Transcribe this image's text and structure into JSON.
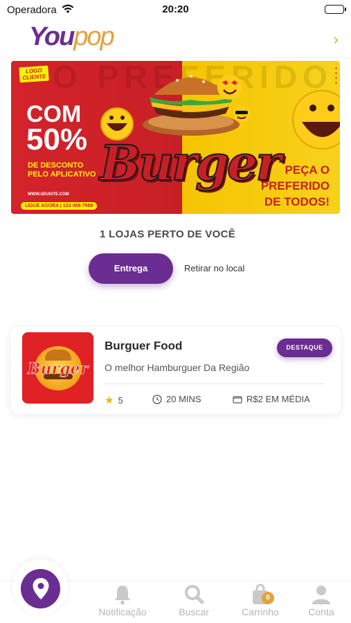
{
  "status_bar": {
    "carrier": "Operadora",
    "time": "20:20"
  },
  "header": {
    "logo_part1": "You",
    "logo_part2": "pop",
    "chevron": "›"
  },
  "banner": {
    "bg_word": "O PREFERIDO",
    "logo_tag_1": "LOGO",
    "logo_tag_2": "CLIENTE",
    "headline_1": "COM",
    "headline_2": "50%",
    "subline_1": "DE DESCONTO",
    "subline_2": "PELO APLICATIVO",
    "site": "WWW.SEUSITE.COM",
    "phone": "LIGUE AGORA | 123-456-7689",
    "burger_word": "Burger",
    "cta_1": "PEÇA O",
    "cta_2": "PREFERIDO",
    "cta_3": "DE TODOS!"
  },
  "section_title": "1 LOJAS PERTO DE VOCÊ",
  "tabs": {
    "active": "Entrega",
    "inactive": "Retirar no local"
  },
  "store": {
    "name": "Burguer Food",
    "description": "O melhor Hamburguer Da Região",
    "badge": "DESTAQUE",
    "logo_word": "Burger",
    "rating": "5",
    "time": "20 MINS",
    "price": "R$2 EM MÉDIA"
  },
  "bottom_nav": {
    "notifications": "Notificação",
    "search": "Buscar",
    "cart": "Carrinho",
    "cart_count": "0",
    "account": "Conta"
  },
  "colors": {
    "brand_purple": "#6a2d91",
    "brand_gold": "#e3a23a",
    "banner_red": "#d4232a",
    "banner_yellow": "#f6c400"
  },
  "icons": [
    "wifi-icon",
    "battery-icon",
    "chevron-right-icon",
    "star-icon",
    "clock-icon",
    "wallet-icon",
    "location-pin-icon",
    "bell-icon",
    "search-icon",
    "bag-icon",
    "user-icon"
  ]
}
